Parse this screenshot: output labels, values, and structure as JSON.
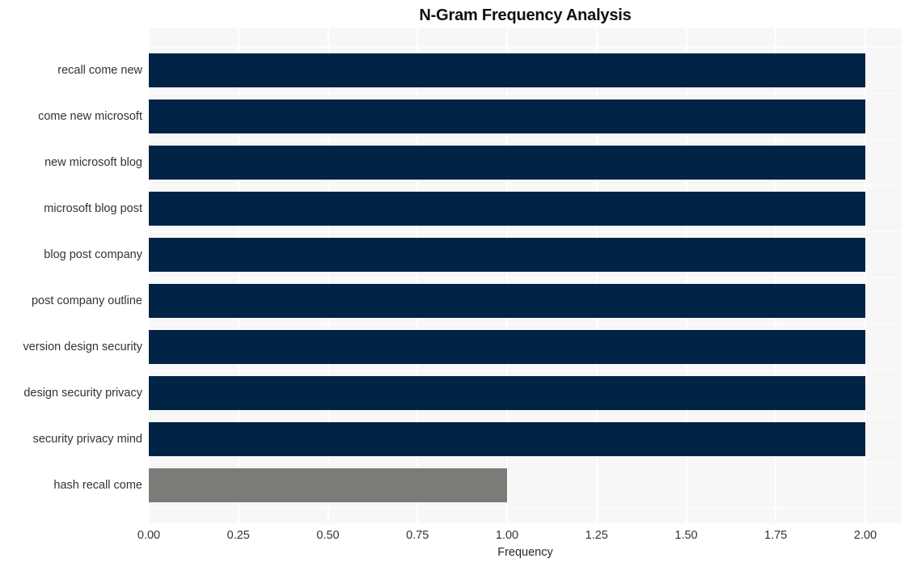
{
  "chart_data": {
    "type": "bar",
    "orientation": "horizontal",
    "title": "N-Gram Frequency Analysis",
    "xlabel": "Frequency",
    "ylabel": "",
    "categories": [
      "recall come new",
      "come new microsoft",
      "new microsoft blog",
      "microsoft blog post",
      "blog post company",
      "post company outline",
      "version design security",
      "design security privacy",
      "security privacy mind",
      "hash recall come"
    ],
    "values": [
      2,
      2,
      2,
      2,
      2,
      2,
      2,
      2,
      2,
      1
    ],
    "bar_colors": [
      "#012345",
      "#012345",
      "#012345",
      "#012345",
      "#012345",
      "#012345",
      "#012345",
      "#012345",
      "#012345",
      "#7d7b78"
    ],
    "xlim": [
      0,
      2
    ],
    "xticks": [
      0,
      0.25,
      0.5,
      0.75,
      1,
      1.25,
      1.5,
      1.75,
      2
    ],
    "xtick_labels": [
      "0.00",
      "0.25",
      "0.50",
      "0.75",
      "1.00",
      "1.25",
      "1.50",
      "1.75",
      "2.00"
    ],
    "grid": true,
    "grid_color": "#ffffff",
    "plot_background": "#f7f7f7",
    "figure_background": "#ffffff",
    "legend": null
  }
}
